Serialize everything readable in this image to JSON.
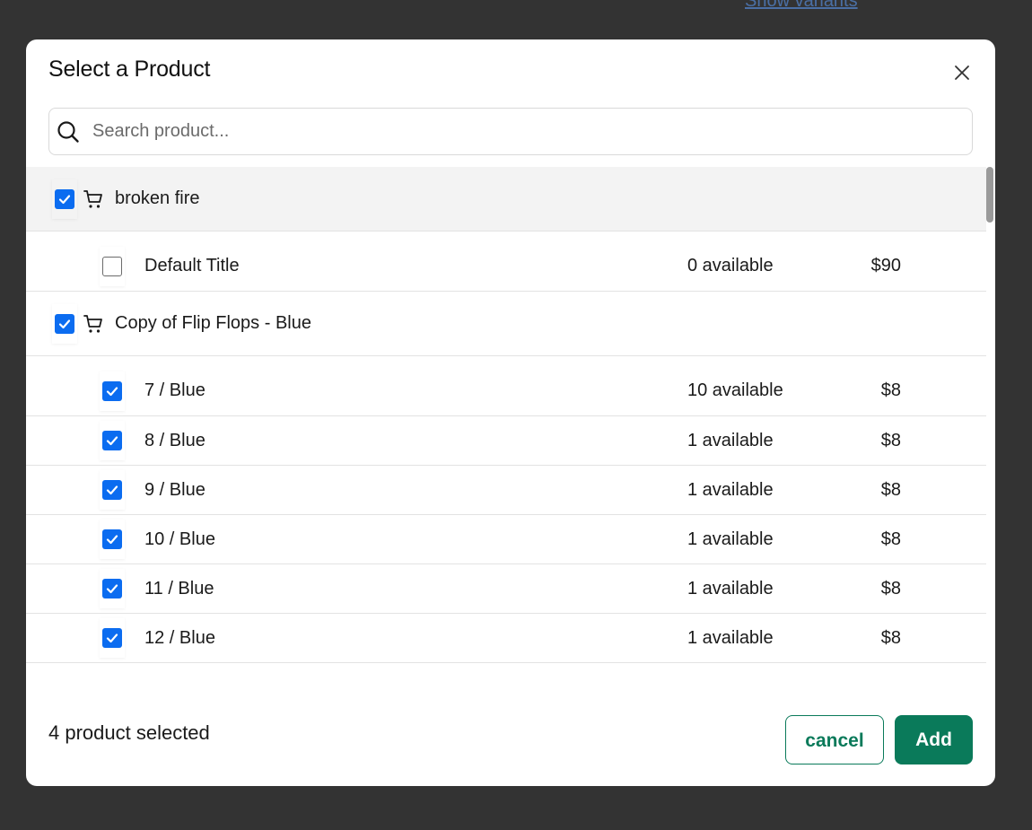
{
  "background": {
    "link_label": "Show variants",
    "color": "#333333"
  },
  "modal": {
    "title": "Select a Product",
    "close_icon": "close-icon",
    "search": {
      "placeholder": "Search product...",
      "value": ""
    },
    "products": [
      {
        "name": "broken fire",
        "checked": true,
        "highlighted": true,
        "variants": [
          {
            "name": "Default Title",
            "available": "0 available",
            "price": "$90",
            "checked": false
          }
        ]
      },
      {
        "name": "Copy of Flip Flops - Blue",
        "checked": true,
        "highlighted": false,
        "variants": [
          {
            "name": "7 / Blue",
            "available": "10 available",
            "price": "$8",
            "checked": true
          },
          {
            "name": "8 / Blue",
            "available": "1 available",
            "price": "$8",
            "checked": true
          },
          {
            "name": "9 / Blue",
            "available": "1 available",
            "price": "$8",
            "checked": true
          },
          {
            "name": "10 / Blue",
            "available": "1 available",
            "price": "$8",
            "checked": true
          },
          {
            "name": "11 / Blue",
            "available": "1 available",
            "price": "$8",
            "checked": true
          },
          {
            "name": "12 / Blue",
            "available": "1 available",
            "price": "$8",
            "checked": true
          }
        ]
      }
    ],
    "footer": {
      "selected_text": "4 product selected",
      "cancel_label": "cancel",
      "add_label": "Add"
    }
  },
  "colors": {
    "accent_green": "#0a7a5a",
    "checkbox_blue": "#0b6cf0"
  }
}
